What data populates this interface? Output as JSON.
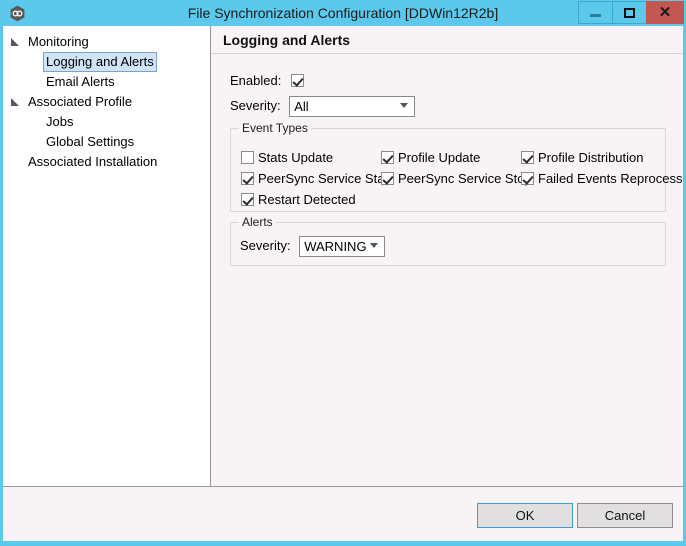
{
  "window": {
    "title": "File Synchronization Configuration [DDWin12R2b]",
    "icon": "app-link-icon",
    "accent_titlebar": "#5bc8ec",
    "accent_close": "#c25650",
    "client_background": "#f8f4f6",
    "controls": {
      "minimize": "minimize",
      "maximize": "maximize",
      "close": "close",
      "close_glyph": "✕"
    }
  },
  "tree": {
    "items": [
      {
        "label": "Monitoring",
        "indent": 0,
        "expander": "expanded-triangle",
        "selected": false
      },
      {
        "label": "Logging and Alerts",
        "indent": 1,
        "expander": "",
        "selected": true
      },
      {
        "label": "Email Alerts",
        "indent": 1,
        "expander": "",
        "selected": false
      },
      {
        "label": "Associated Profile",
        "indent": 0,
        "expander": "expanded-triangle",
        "selected": false
      },
      {
        "label": "Jobs",
        "indent": 1,
        "expander": "",
        "selected": false
      },
      {
        "label": "Global Settings",
        "indent": 1,
        "expander": "",
        "selected": false
      },
      {
        "label": "Associated Installation",
        "indent": 0,
        "expander": "",
        "selected": false
      }
    ]
  },
  "content": {
    "header": "Logging and Alerts",
    "enabled": {
      "label": "Enabled:",
      "checked": true
    },
    "severity": {
      "label": "Severity:",
      "value": "All"
    },
    "event_types": {
      "title": "Event Types",
      "items": [
        {
          "label": "Stats Update",
          "checked": false,
          "col": 0,
          "row": 0
        },
        {
          "label": "Profile Update",
          "checked": true,
          "col": 1,
          "row": 0
        },
        {
          "label": "Profile Distribution",
          "checked": true,
          "col": 2,
          "row": 0
        },
        {
          "label": "PeerSync Service Start",
          "checked": true,
          "col": 0,
          "row": 1
        },
        {
          "label": "PeerSync Service Stop",
          "checked": true,
          "col": 1,
          "row": 1
        },
        {
          "label": "Failed Events Reprocess",
          "checked": true,
          "col": 2,
          "row": 1
        },
        {
          "label": "Restart Detected",
          "checked": true,
          "col": 0,
          "row": 2
        }
      ]
    },
    "alerts": {
      "title": "Alerts",
      "severity": {
        "label": "Severity:",
        "value": "WARNING"
      }
    }
  },
  "footer": {
    "ok_label": "OK",
    "cancel_label": "Cancel"
  }
}
